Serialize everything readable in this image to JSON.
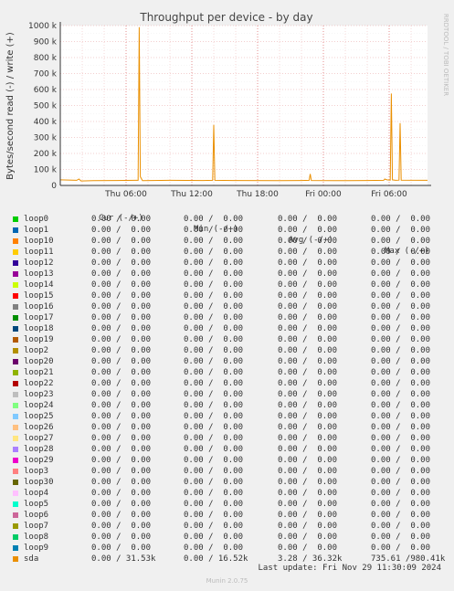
{
  "chart_data": {
    "type": "line",
    "title": "Throughput per device - by day",
    "ylabel": "Bytes/second read (-) / write (+)",
    "side_label": "RRDTOOL / TOBI OETIKER",
    "ylim": [
      0,
      1000000
    ],
    "yticks": [
      {
        "v": 0,
        "label": "0"
      },
      {
        "v": 100000,
        "label": "100 k"
      },
      {
        "v": 200000,
        "label": "200 k"
      },
      {
        "v": 300000,
        "label": "300 k"
      },
      {
        "v": 400000,
        "label": "400 k"
      },
      {
        "v": 500000,
        "label": "500 k"
      },
      {
        "v": 600000,
        "label": "600 k"
      },
      {
        "v": 700000,
        "label": "700 k"
      },
      {
        "v": 800000,
        "label": "800 k"
      },
      {
        "v": 900000,
        "label": "900 k"
      },
      {
        "v": 1000000,
        "label": "1000 k"
      }
    ],
    "x_range_hours": [
      0,
      33.5
    ],
    "xticks": [
      {
        "h": 6,
        "label": "Thu 06:00"
      },
      {
        "h": 12,
        "label": "Thu 12:00"
      },
      {
        "h": 18,
        "label": "Thu 18:00"
      },
      {
        "h": 24,
        "label": "Fri 00:00"
      },
      {
        "h": 30,
        "label": "Fri 06:00"
      }
    ],
    "series": [
      {
        "name": "sda",
        "color": "#ea8f00",
        "points": [
          [
            0,
            35000
          ],
          [
            1.5,
            32000
          ],
          [
            1.7,
            40000
          ],
          [
            1.9,
            28000
          ],
          [
            3,
            30000
          ],
          [
            5,
            31000
          ],
          [
            6.8,
            32000
          ],
          [
            7.1,
            32000
          ],
          [
            7.2,
            990000
          ],
          [
            7.3,
            55000
          ],
          [
            7.5,
            30000
          ],
          [
            10,
            32000
          ],
          [
            13,
            31000
          ],
          [
            13.9,
            32000
          ],
          [
            14.0,
            378000
          ],
          [
            14.1,
            32000
          ],
          [
            16,
            31000
          ],
          [
            20,
            30000
          ],
          [
            22,
            31000
          ],
          [
            22.7,
            32000
          ],
          [
            22.8,
            72000
          ],
          [
            22.9,
            31000
          ],
          [
            25,
            30000
          ],
          [
            28,
            31000
          ],
          [
            29.5,
            32000
          ],
          [
            29.6,
            40000
          ],
          [
            29.8,
            35000
          ],
          [
            30.1,
            33000
          ],
          [
            30.2,
            575000
          ],
          [
            30.3,
            35000
          ],
          [
            30.6,
            32000
          ],
          [
            30.9,
            33000
          ],
          [
            31.0,
            390000
          ],
          [
            31.1,
            33000
          ],
          [
            33.5,
            32000
          ]
        ]
      }
    ]
  },
  "legend": {
    "headers": [
      "Cur (-/+)",
      "Min (-/+)",
      "Avg (-/+)",
      "Max (-/+)"
    ],
    "rows": [
      {
        "name": "loop0",
        "color": "#00cc00",
        "cur": "0.00 /  0.00",
        "min": "0.00 /  0.00",
        "avg": "0.00 /  0.00",
        "max": "0.00 /  0.00"
      },
      {
        "name": "loop1",
        "color": "#0066b3",
        "cur": "0.00 /  0.00",
        "min": "0.00 /  0.00",
        "avg": "0.00 /  0.00",
        "max": "0.00 /  0.00"
      },
      {
        "name": "loop10",
        "color": "#ff8000",
        "cur": "0.00 /  0.00",
        "min": "0.00 /  0.00",
        "avg": "0.00 /  0.00",
        "max": "0.00 /  0.00"
      },
      {
        "name": "loop11",
        "color": "#ffcc00",
        "cur": "0.00 /  0.00",
        "min": "0.00 /  0.00",
        "avg": "0.00 /  0.00",
        "max": "0.00 /  0.00"
      },
      {
        "name": "loop12",
        "color": "#330099",
        "cur": "0.00 /  0.00",
        "min": "0.00 /  0.00",
        "avg": "0.00 /  0.00",
        "max": "0.00 /  0.00"
      },
      {
        "name": "loop13",
        "color": "#990099",
        "cur": "0.00 /  0.00",
        "min": "0.00 /  0.00",
        "avg": "0.00 /  0.00",
        "max": "0.00 /  0.00"
      },
      {
        "name": "loop14",
        "color": "#ccff00",
        "cur": "0.00 /  0.00",
        "min": "0.00 /  0.00",
        "avg": "0.00 /  0.00",
        "max": "0.00 /  0.00"
      },
      {
        "name": "loop15",
        "color": "#ff0000",
        "cur": "0.00 /  0.00",
        "min": "0.00 /  0.00",
        "avg": "0.00 /  0.00",
        "max": "0.00 /  0.00"
      },
      {
        "name": "loop16",
        "color": "#808080",
        "cur": "0.00 /  0.00",
        "min": "0.00 /  0.00",
        "avg": "0.00 /  0.00",
        "max": "0.00 /  0.00"
      },
      {
        "name": "loop17",
        "color": "#008f00",
        "cur": "0.00 /  0.00",
        "min": "0.00 /  0.00",
        "avg": "0.00 /  0.00",
        "max": "0.00 /  0.00"
      },
      {
        "name": "loop18",
        "color": "#00487d",
        "cur": "0.00 /  0.00",
        "min": "0.00 /  0.00",
        "avg": "0.00 /  0.00",
        "max": "0.00 /  0.00"
      },
      {
        "name": "loop19",
        "color": "#b35a00",
        "cur": "0.00 /  0.00",
        "min": "0.00 /  0.00",
        "avg": "0.00 /  0.00",
        "max": "0.00 /  0.00"
      },
      {
        "name": "loop2",
        "color": "#b38f00",
        "cur": "0.00 /  0.00",
        "min": "0.00 /  0.00",
        "avg": "0.00 /  0.00",
        "max": "0.00 /  0.00"
      },
      {
        "name": "loop20",
        "color": "#6b006b",
        "cur": "0.00 /  0.00",
        "min": "0.00 /  0.00",
        "avg": "0.00 /  0.00",
        "max": "0.00 /  0.00"
      },
      {
        "name": "loop21",
        "color": "#8fb300",
        "cur": "0.00 /  0.00",
        "min": "0.00 /  0.00",
        "avg": "0.00 /  0.00",
        "max": "0.00 /  0.00"
      },
      {
        "name": "loop22",
        "color": "#b30000",
        "cur": "0.00 /  0.00",
        "min": "0.00 /  0.00",
        "avg": "0.00 /  0.00",
        "max": "0.00 /  0.00"
      },
      {
        "name": "loop23",
        "color": "#bebebe",
        "cur": "0.00 /  0.00",
        "min": "0.00 /  0.00",
        "avg": "0.00 /  0.00",
        "max": "0.00 /  0.00"
      },
      {
        "name": "loop24",
        "color": "#80ff80",
        "cur": "0.00 /  0.00",
        "min": "0.00 /  0.00",
        "avg": "0.00 /  0.00",
        "max": "0.00 /  0.00"
      },
      {
        "name": "loop25",
        "color": "#80c9ff",
        "cur": "0.00 /  0.00",
        "min": "0.00 /  0.00",
        "avg": "0.00 /  0.00",
        "max": "0.00 /  0.00"
      },
      {
        "name": "loop26",
        "color": "#ffc080",
        "cur": "0.00 /  0.00",
        "min": "0.00 /  0.00",
        "avg": "0.00 /  0.00",
        "max": "0.00 /  0.00"
      },
      {
        "name": "loop27",
        "color": "#ffe680",
        "cur": "0.00 /  0.00",
        "min": "0.00 /  0.00",
        "avg": "0.00 /  0.00",
        "max": "0.00 /  0.00"
      },
      {
        "name": "loop28",
        "color": "#aa80ff",
        "cur": "0.00 /  0.00",
        "min": "0.00 /  0.00",
        "avg": "0.00 /  0.00",
        "max": "0.00 /  0.00"
      },
      {
        "name": "loop29",
        "color": "#ee00cc",
        "cur": "0.00 /  0.00",
        "min": "0.00 /  0.00",
        "avg": "0.00 /  0.00",
        "max": "0.00 /  0.00"
      },
      {
        "name": "loop3",
        "color": "#ff8080",
        "cur": "0.00 /  0.00",
        "min": "0.00 /  0.00",
        "avg": "0.00 /  0.00",
        "max": "0.00 /  0.00"
      },
      {
        "name": "loop30",
        "color": "#666600",
        "cur": "0.00 /  0.00",
        "min": "0.00 /  0.00",
        "avg": "0.00 /  0.00",
        "max": "0.00 /  0.00"
      },
      {
        "name": "loop4",
        "color": "#ffbfff",
        "cur": "0.00 /  0.00",
        "min": "0.00 /  0.00",
        "avg": "0.00 /  0.00",
        "max": "0.00 /  0.00"
      },
      {
        "name": "loop5",
        "color": "#00ffcc",
        "cur": "0.00 /  0.00",
        "min": "0.00 /  0.00",
        "avg": "0.00 /  0.00",
        "max": "0.00 /  0.00"
      },
      {
        "name": "loop6",
        "color": "#cc6699",
        "cur": "0.00 /  0.00",
        "min": "0.00 /  0.00",
        "avg": "0.00 /  0.00",
        "max": "0.00 /  0.00"
      },
      {
        "name": "loop7",
        "color": "#999900",
        "cur": "0.00 /  0.00",
        "min": "0.00 /  0.00",
        "avg": "0.00 /  0.00",
        "max": "0.00 /  0.00"
      },
      {
        "name": "loop8",
        "color": "#00cc66",
        "cur": "0.00 /  0.00",
        "min": "0.00 /  0.00",
        "avg": "0.00 /  0.00",
        "max": "0.00 /  0.00"
      },
      {
        "name": "loop9",
        "color": "#0080b3",
        "cur": "0.00 /  0.00",
        "min": "0.00 /  0.00",
        "avg": "0.00 /  0.00",
        "max": "0.00 /  0.00"
      },
      {
        "name": "sda",
        "color": "#ea8f00",
        "cur": "0.00 / 31.53k",
        "min": "0.00 / 16.52k",
        "avg": "3.28 / 36.32k",
        "max": "735.61 /980.41k"
      }
    ]
  },
  "last_update": "Last update: Fri Nov 29 11:30:09 2024",
  "footer": "Munin 2.0.75"
}
